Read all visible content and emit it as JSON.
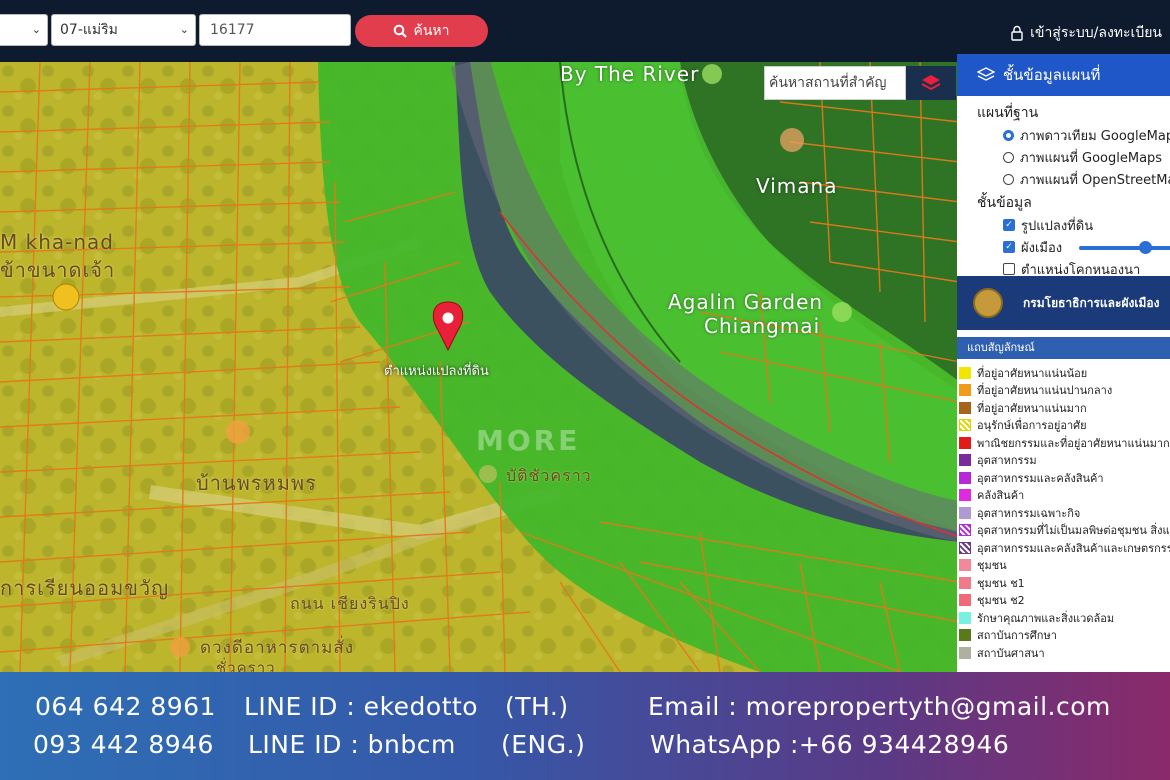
{
  "topbar": {
    "select_partial": "",
    "district_select": "07-แม่ริม",
    "parcel_input": "16177",
    "search_label": "ค้นหา",
    "login_label": "เข้าสู่ระบบ/ลงทะเบียน"
  },
  "map": {
    "place_search_placeholder": "ค้นหาสถานที่สำคัญ",
    "labels": {
      "by_the_river": "By The River",
      "vimana": "Vimana",
      "agalin": "Agalin Garden",
      "chiangmai": "Chiangmai",
      "m_kha_nad": "M kha-nad",
      "kha_nad_chao": "ข้าขนาดเจ้า",
      "ban_phrom": "บ้านพรหมพร",
      "wat_chiang_rai": "บัติชัวคราว",
      "school": "การเรียนออมขวัญ",
      "road": "ถนน เชียงรินปิง",
      "restaurant": "ดวงดีอาหารตามสั่ง",
      "restaurant2": "ชั่วคราว"
    },
    "pin_label": "ตำแหน่งแปลงที่ดิน",
    "watermark": "MORE"
  },
  "panel": {
    "title": "ชั้นข้อมูลแผนที่",
    "basemap_title": "แผนที่ฐาน",
    "basemaps": [
      {
        "label": "ภาพดาวเทียม GoogleMaps",
        "selected": true
      },
      {
        "label": "ภาพแผนที่ GoogleMaps",
        "selected": false
      },
      {
        "label": "ภาพแผนที่ OpenStreetMap",
        "selected": false
      }
    ],
    "layers_title": "ชั้นข้อมูล",
    "layers": [
      {
        "label": "รูปแปลงที่ดิน",
        "checked": true
      },
      {
        "label": "ผังเมือง",
        "checked": true
      },
      {
        "label": "ตำแหน่งโคกหนองนา",
        "checked": false
      }
    ],
    "department": "กรมโยธาธิการและผังเมือง",
    "legend_title": "แถบสัญลักษณ์",
    "legend": [
      {
        "label": "ที่อยู่อาศัยหนาแน่นน้อย",
        "color": "#f2e600",
        "hatch": false
      },
      {
        "label": "ที่อยู่อาศัยหนาแน่นปานกลาง",
        "color": "#f29a1a",
        "hatch": false
      },
      {
        "label": "ที่อยู่อาศัยหนาแน่นมาก",
        "color": "#a5641d",
        "hatch": false
      },
      {
        "label": "อนุรักษ์เพื่อการอยู่อาศัย",
        "color": "#e0d400",
        "hatch": true
      },
      {
        "label": "พาณิชยกรรมและที่อยู่อาศัยหนาแน่นมาก",
        "color": "#e31a1a",
        "hatch": false
      },
      {
        "label": "อุตสาหกรรม",
        "color": "#7a2a9a",
        "hatch": false
      },
      {
        "label": "อุตสาหกรรมและคลังสินค้า",
        "color": "#b52ad6",
        "hatch": false
      },
      {
        "label": "คลังสินค้า",
        "color": "#e02ae0",
        "hatch": false
      },
      {
        "label": "อุตสาหกรรมเฉพาะกิจ",
        "color": "#b09ad6",
        "hatch": false
      },
      {
        "label": "อุตสาหกรรมที่ไม่เป็นมลพิษต่อชุมชน สิ่งแวดล้อม",
        "color": "#b52ad6",
        "hatch": true
      },
      {
        "label": "อุตสาหกรรมและคลังสินค้าและเกษตรกรรม",
        "color": "#6a3a8a",
        "hatch": true
      },
      {
        "label": "ชุมชน",
        "color": "#f08a9a",
        "hatch": false
      },
      {
        "label": "ชุมชน ช1",
        "color": "#f07a8a",
        "hatch": false
      },
      {
        "label": "ชุมชน ช2",
        "color": "#f06a7a",
        "hatch": false
      },
      {
        "label": "รักษาคุณภาพและสิ่งแวดล้อม",
        "color": "#7af0e0",
        "hatch": false
      },
      {
        "label": "สถาบันการศึกษา",
        "color": "#5a7a1a",
        "hatch": false
      },
      {
        "label": "สถาบันศาสนา",
        "color": "#b0b0a0",
        "hatch": false
      }
    ]
  },
  "footer": {
    "phone1": "064 642 8961",
    "line1": "LINE ID : ekedotto",
    "lang1": "(TH.)",
    "email": "Email : morepropertyth@gmail.com",
    "phone2": "093 442 8946",
    "line2": "LINE ID : bnbcm",
    "lang2": "(ENG.)",
    "whatsapp": "WhatsApp :+66 934428946"
  }
}
